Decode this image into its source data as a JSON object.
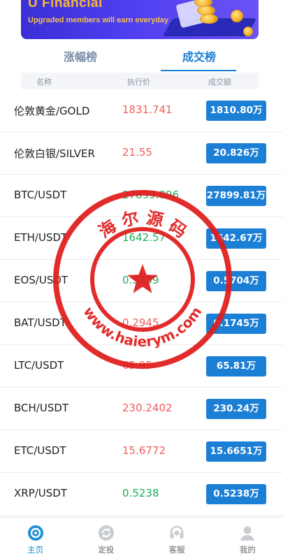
{
  "banner": {
    "title": "U Financial",
    "subtitle": "Upgraded members will earn everyday"
  },
  "tabs": [
    {
      "label": "涨幅榜",
      "active": false
    },
    {
      "label": "成交榜",
      "active": true
    }
  ],
  "columns": {
    "name": "名称",
    "price": "执行价",
    "volume": "成交额"
  },
  "rows": [
    {
      "symbol": "伦敦黄金/GOLD",
      "price": "1831.741",
      "trend": "up",
      "volume": "1810.80万"
    },
    {
      "symbol": "伦敦白银/SILVER",
      "price": "21.55",
      "trend": "up",
      "volume": "20.826万"
    },
    {
      "symbol": "BTC/USDT",
      "price": "27899.896",
      "trend": "down",
      "volume": "27899.81万"
    },
    {
      "symbol": "ETH/USDT",
      "price": "1642.57",
      "trend": "down",
      "volume": "1642.67万"
    },
    {
      "symbol": "EOS/USDT",
      "price": "0.5739",
      "trend": "down",
      "volume": "0.5704万"
    },
    {
      "symbol": "BAT/USDT",
      "price": "0.2945",
      "trend": "up",
      "volume": "0.1745万"
    },
    {
      "symbol": "LTC/USDT",
      "price": "65.95",
      "trend": "up",
      "volume": "65.81万"
    },
    {
      "symbol": "BCH/USDT",
      "price": "230.2402",
      "trend": "up",
      "volume": "230.24万"
    },
    {
      "symbol": "ETC/USDT",
      "price": "15.6772",
      "trend": "up",
      "volume": "15.6651万"
    },
    {
      "symbol": "XRP/USDT",
      "price": "0.5238",
      "trend": "down",
      "volume": "0.5238万"
    }
  ],
  "watermark": {
    "top_text": "海 尔 源 码",
    "bottom_text": "www.haierym.com",
    "color": "#e01b1b"
  },
  "nav": [
    {
      "label": "主页",
      "icon": "home-icon",
      "active": true
    },
    {
      "label": "定投",
      "icon": "invest-icon",
      "active": false
    },
    {
      "label": "客服",
      "icon": "headset-icon",
      "active": false
    },
    {
      "label": "我的",
      "icon": "user-icon",
      "active": false
    }
  ],
  "colors": {
    "accent": "#1a7ed4",
    "up": "#f05d5d",
    "down": "#1fae5a",
    "volume_badge": "#1b7fd6"
  }
}
